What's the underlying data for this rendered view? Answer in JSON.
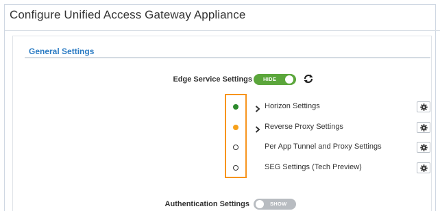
{
  "window": {
    "title": "Configure Unified Access Gateway Appliance"
  },
  "general_settings": {
    "title": "General Settings"
  },
  "edge_service": {
    "label": "Edge Service Settings",
    "toggle_text": "HIDE",
    "toggle_state": "on",
    "refresh_icon": "refresh-icon"
  },
  "services": [
    {
      "label": "Horizon Settings",
      "status": "green",
      "status_color": "#2d8a2d",
      "expandable": true,
      "settings_icon": "gear-icon"
    },
    {
      "label": "Reverse Proxy Settings",
      "status": "orange",
      "status_color": "#f7a11a",
      "expandable": true,
      "settings_icon": "gear-icon"
    },
    {
      "label": "Per App Tunnel and Proxy Settings",
      "status": "none",
      "status_color": "#ffffff",
      "expandable": false,
      "settings_icon": "gear-icon"
    },
    {
      "label": "SEG Settings (Tech Preview)",
      "status": "none",
      "status_color": "#ffffff",
      "expandable": false,
      "settings_icon": "gear-icon"
    }
  ],
  "authentication": {
    "label": "Authentication Settings",
    "toggle_text": "SHOW",
    "toggle_state": "off"
  },
  "colors": {
    "accent": "#2c7cc4",
    "toggle_on": "#5ba63b",
    "highlight_box": "#f7941d"
  }
}
